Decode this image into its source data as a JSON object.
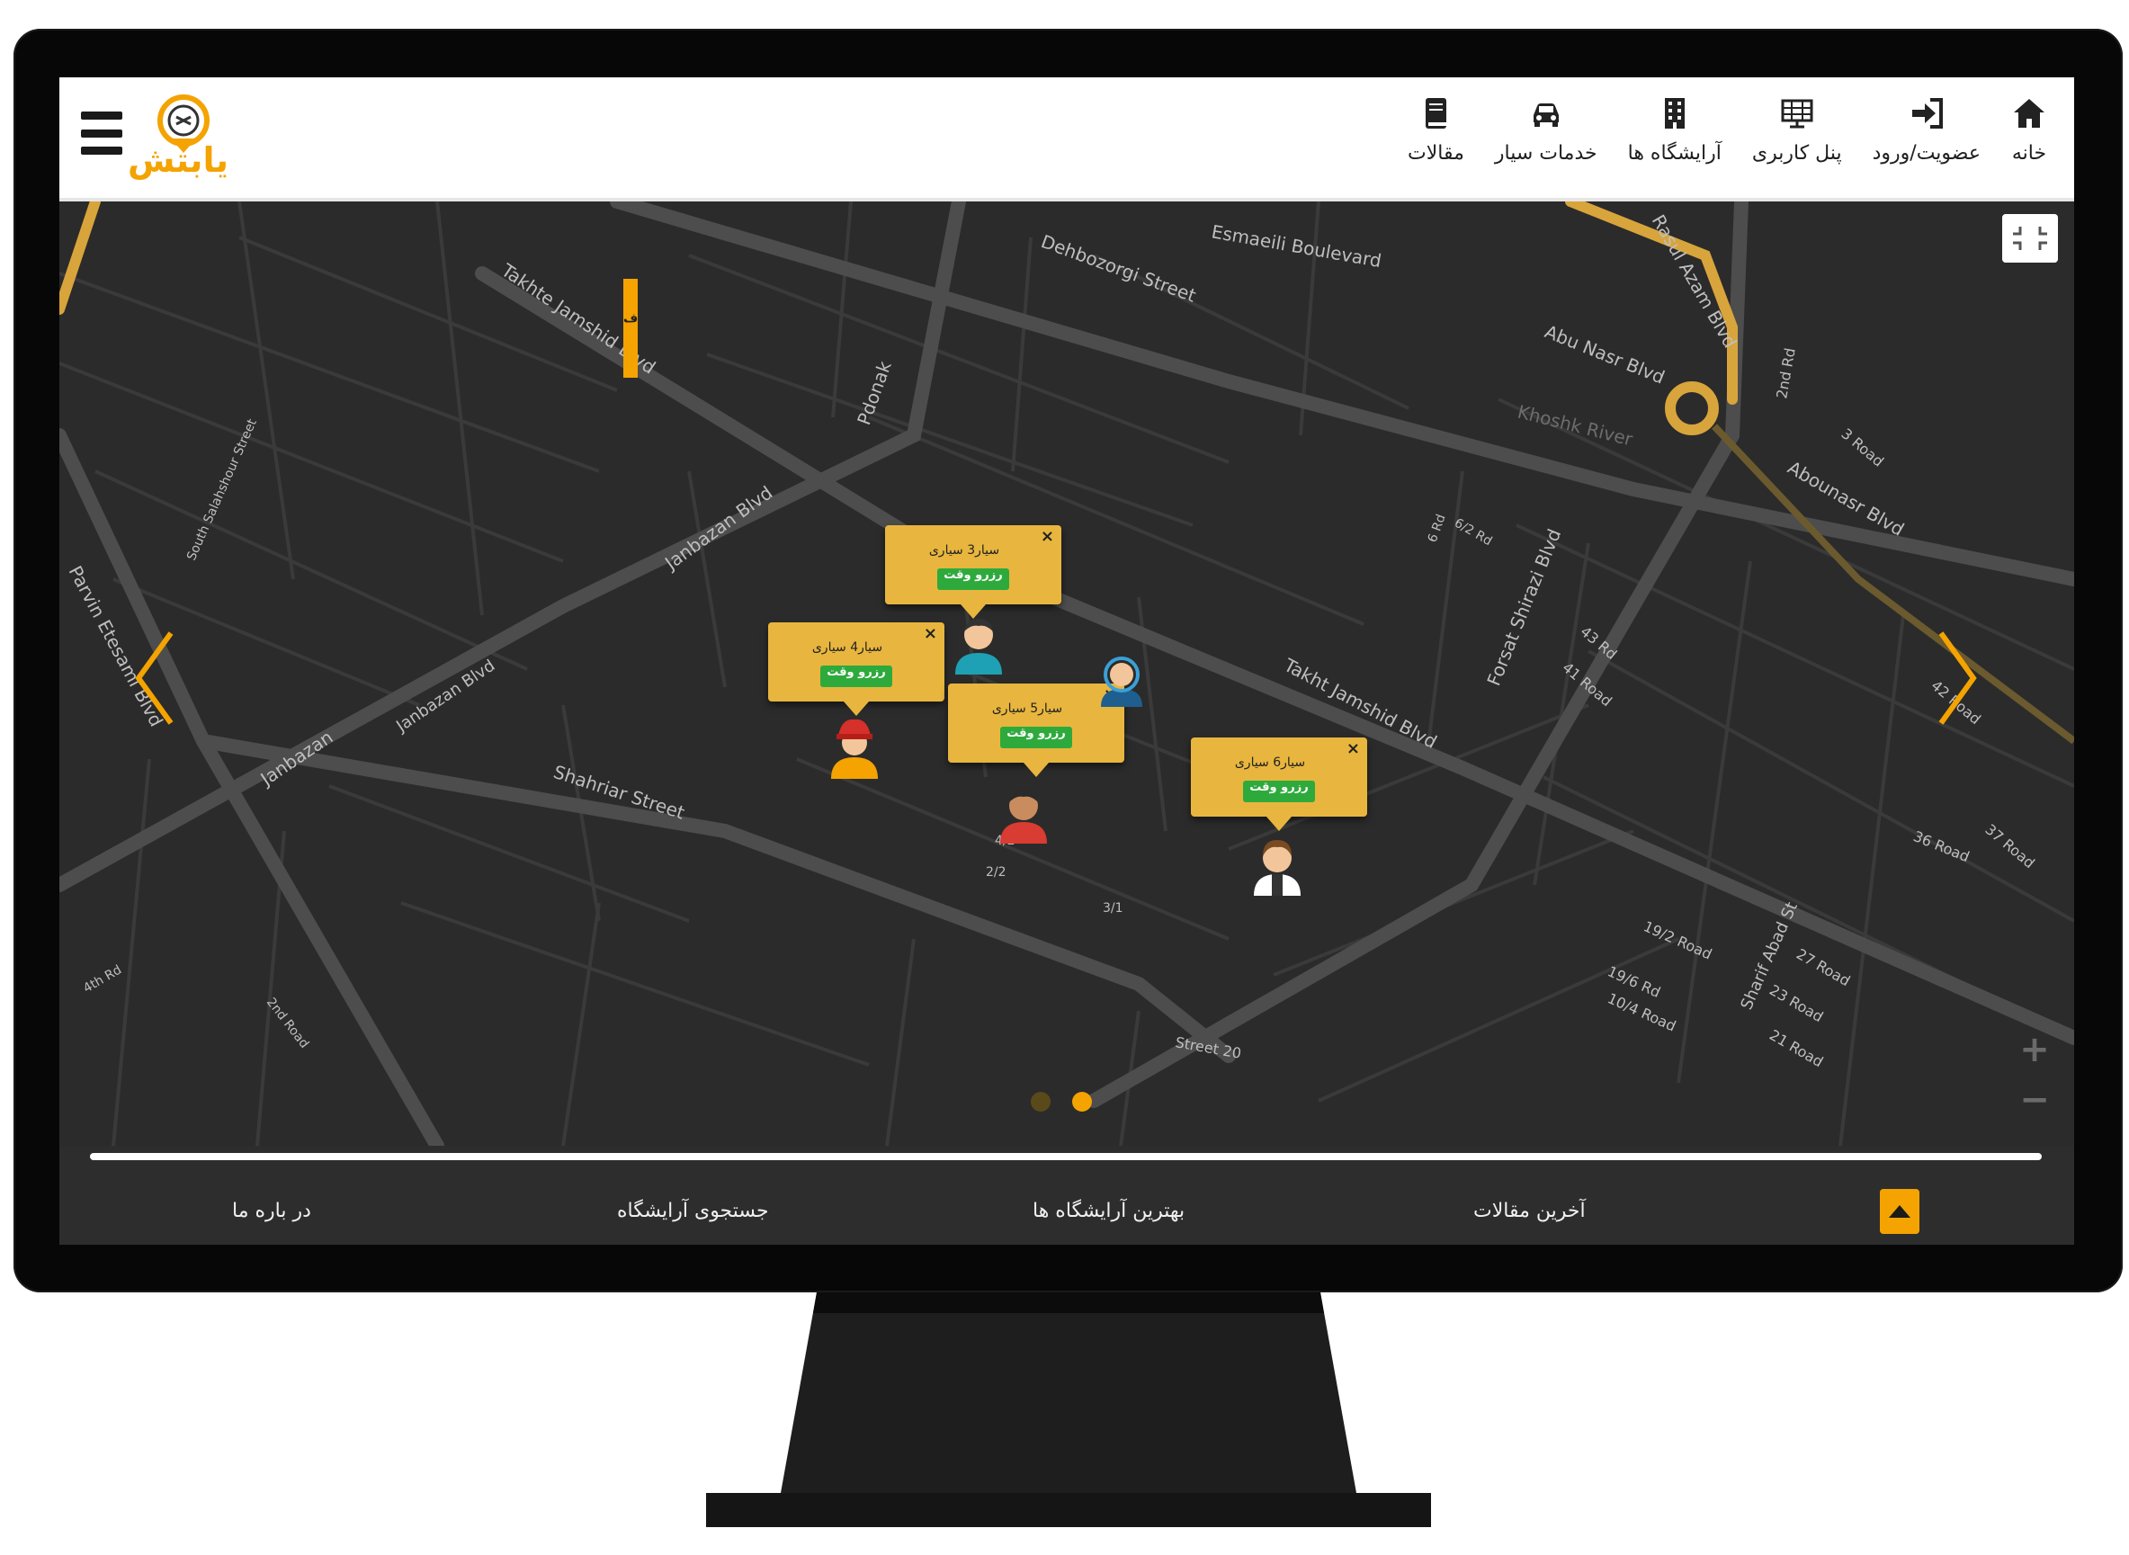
{
  "header": {
    "logo_text": "یابتش",
    "nav": [
      {
        "icon": "home-icon",
        "label": "خانه"
      },
      {
        "icon": "sign-in-icon",
        "label": "عضویت/ورود"
      },
      {
        "icon": "dashboard-icon",
        "label": "پنل کاربری"
      },
      {
        "icon": "building-icon",
        "label": "آرایشگاه ها"
      },
      {
        "icon": "car-icon",
        "label": "خدمات سیار"
      },
      {
        "icon": "book-icon",
        "label": "مقالات"
      }
    ]
  },
  "map": {
    "tab_letter": "ف",
    "street_labels": [
      "Dehbozorgi Street",
      "Esmaeili Boulevard",
      "Abu Nasr Blvd",
      "Rasul Azam Blvd",
      "Takhte Jamshid Blvd",
      "Janbazan Blvd",
      "Pdonak",
      "Khoshk River",
      "Forsat Shirazi Blvd",
      "Abounasr Blvd",
      "Takht Jamshid Blvd",
      "Shahriar Street",
      "Parvin Etesami Blvd",
      "Janbazan",
      "South Salahshour Street",
      "36 Road",
      "37 Road",
      "42 Road",
      "43 Rd",
      "41 Road",
      "3 Road",
      "2nd Rd",
      "21 Road",
      "23 Road",
      "27 Road",
      "Sharif Abad St",
      "Street 20",
      "4th Rd",
      "19/2 Road",
      "19/6 Rd",
      "10/4 Road",
      "Janbazan Blvd",
      "2nd Road",
      "3/1",
      "2/2",
      "4/2",
      "6 Rd",
      "6/2 Rd"
    ],
    "popups": [
      {
        "title": "سیار3 سیاری",
        "button": "رزرو وقت"
      },
      {
        "title": "سیار4 سیاری",
        "button": "رزرو وقت"
      },
      {
        "title": "سیار5 سیاری",
        "button": "رزرو وقت"
      },
      {
        "title": "سیار6 سیاری",
        "button": "رزرو وقت"
      }
    ],
    "zoom_in": "+",
    "zoom_out": "−",
    "colors": {
      "accent": "#f4a300",
      "popup": "#e8b63e",
      "book_button": "#2eaa3c",
      "map_bg": "#2b2b2b",
      "road": "#4a4a4a"
    }
  },
  "footer": {
    "links": [
      "در باره ما",
      "جستجوی آرایشگاه",
      "بهترین آرایشگاه ها",
      "آخرین مقالات"
    ]
  }
}
